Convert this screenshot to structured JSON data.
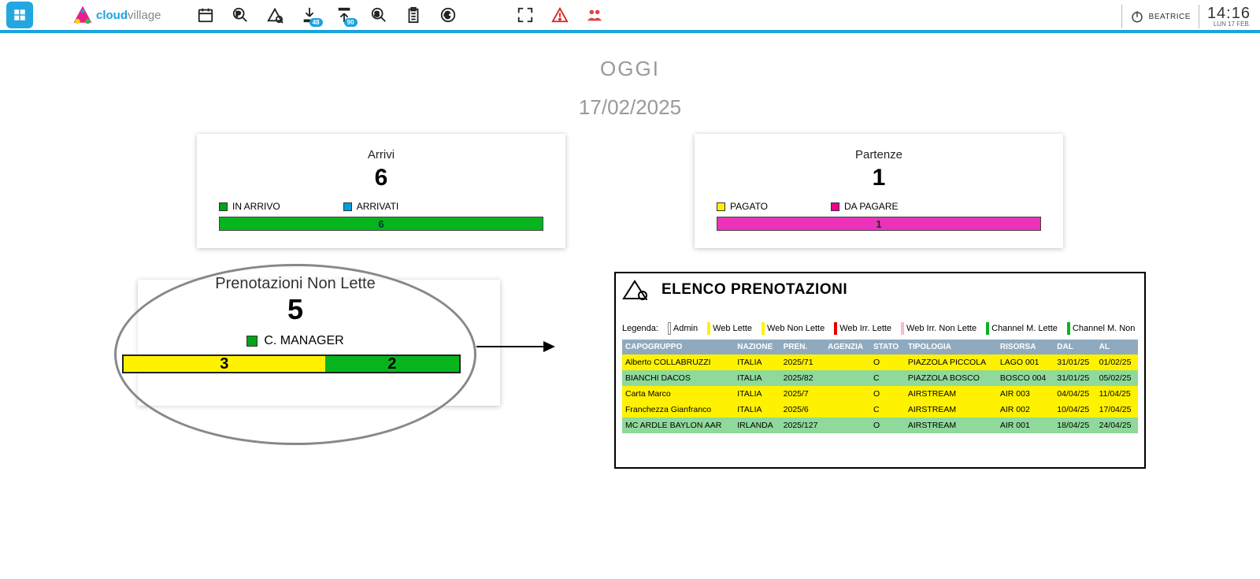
{
  "brand": {
    "part1": "cloud",
    "part2": "village"
  },
  "user": {
    "name": "BEATRICE"
  },
  "clock": {
    "time": "14:16",
    "date": "LUN 17 FEB."
  },
  "toolbar_badges": {
    "checkin": "48",
    "checkout": "90"
  },
  "today": {
    "label": "OGGI",
    "date": "17/02/2025"
  },
  "arrivi": {
    "title": "Arrivi",
    "count": "6",
    "legend": {
      "in_arrivo": "IN ARRIVO",
      "arrivati": "ARRIVATI"
    },
    "bar_value": "6"
  },
  "partenze": {
    "title": "Partenze",
    "count": "1",
    "legend": {
      "pagato": "PAGATO",
      "da_pagare": "DA PAGARE"
    },
    "bar_value": "1"
  },
  "prenotazioni": {
    "title": "Prenotazioni Non Lette",
    "count": "5",
    "manager_label": "C. MANAGER",
    "seg1": "3",
    "seg2": "2"
  },
  "elenco": {
    "title": "ELENCO PRENOTAZIONI",
    "legenda_label": "Legenda:",
    "legend": {
      "admin": "Admin",
      "web_lette": "Web Lette",
      "web_non_lette": "Web Non Lette",
      "web_irr_lette": "Web Irr. Lette",
      "web_irr_non_lette": "Web Irr. Non Lette",
      "cm_lette": "Channel M. Lette",
      "cm_non": "Channel M. Non"
    },
    "headers": {
      "capogruppo": "CAPOGRUPPO",
      "nazione": "NAZIONE",
      "pren": "PREN.",
      "agenzia": "AGENZIA",
      "stato": "STATO",
      "tipologia": "TIPOLOGIA",
      "risorsa": "RISORSA",
      "dal": "DAL",
      "al": "AL"
    },
    "rows": [
      {
        "cls": "row-yellow",
        "capogruppo": "Alberto COLLABRUZZI",
        "nazione": "ITALIA",
        "pren": "2025/71",
        "agenzia": "",
        "stato": "O",
        "tipologia": "PIAZZOLA PICCOLA",
        "risorsa": "LAGO 001",
        "dal": "31/01/25",
        "al": "01/02/25"
      },
      {
        "cls": "row-green",
        "capogruppo": "BIANCHI DACOS",
        "nazione": "ITALIA",
        "pren": "2025/82",
        "agenzia": "",
        "stato": "C",
        "tipologia": "PIAZZOLA BOSCO",
        "risorsa": "BOSCO 004",
        "dal": "31/01/25",
        "al": "05/02/25"
      },
      {
        "cls": "row-yellow",
        "capogruppo": "Carta Marco",
        "nazione": "ITALIA",
        "pren": "2025/7",
        "agenzia": "",
        "stato": "O",
        "tipologia": "AIRSTREAM",
        "risorsa": "AIR 003",
        "dal": "04/04/25",
        "al": "11/04/25"
      },
      {
        "cls": "row-yellow",
        "capogruppo": "Franchezza Gianfranco",
        "nazione": "ITALIA",
        "pren": "2025/6",
        "agenzia": "",
        "stato": "C",
        "tipologia": "AIRSTREAM",
        "risorsa": "AIR 002",
        "dal": "10/04/25",
        "al": "17/04/25"
      },
      {
        "cls": "row-green",
        "capogruppo": "MC ARDLE BAYLON AAR",
        "nazione": "IRLANDA",
        "pren": "2025/127",
        "agenzia": "",
        "stato": "O",
        "tipologia": "AIRSTREAM",
        "risorsa": "AIR 001",
        "dal": "18/04/25",
        "al": "24/04/25"
      }
    ]
  }
}
